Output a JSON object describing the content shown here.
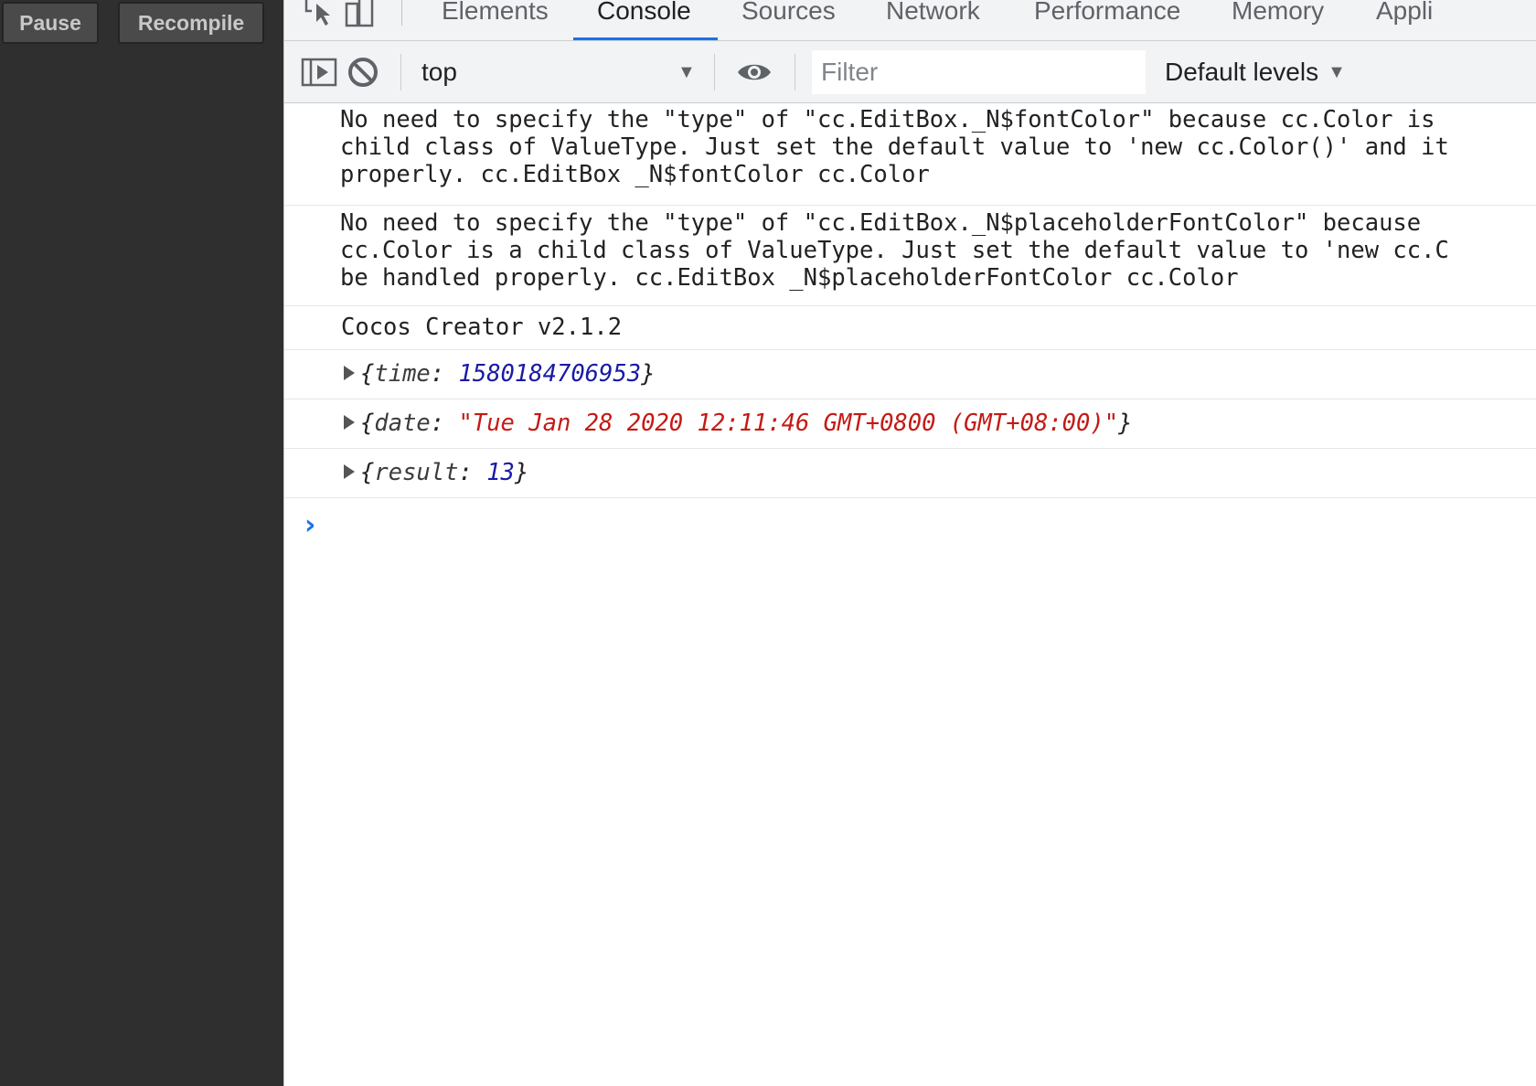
{
  "left_panel": {
    "pause_label": "Pause",
    "recompile_label": "Recompile"
  },
  "tabs": [
    {
      "label": "Elements"
    },
    {
      "label": "Console",
      "active": true
    },
    {
      "label": "Sources"
    },
    {
      "label": "Network"
    },
    {
      "label": "Performance"
    },
    {
      "label": "Memory"
    },
    {
      "label": "Appli"
    }
  ],
  "toolbar": {
    "context": "top",
    "filter_placeholder": "Filter",
    "filter_value": "",
    "levels_label": "Default levels"
  },
  "messages": [
    {
      "lines": [
        "No need to specify the \"type\" of \"cc.EditBox._N$fontColor\" because cc.Color is",
        "child class of ValueType. Just set the default value to 'new cc.Color()' and it",
        "properly. cc.EditBox _N$fontColor cc.Color"
      ]
    },
    {
      "lines": [
        "No need to specify the \"type\" of \"cc.EditBox._N$placeholderFontColor\" because",
        "cc.Color is a child class of ValueType. Just set the default value to 'new cc.C",
        "be handled properly. cc.EditBox _N$placeholderFontColor cc.Color"
      ]
    },
    {
      "lines": [
        "Cocos Creator v2.1.2"
      ]
    }
  ],
  "objects": [
    {
      "key": "time",
      "value": "1580184706953",
      "type": "number"
    },
    {
      "key": "date",
      "value": "\"Tue Jan 28 2020 12:11:46 GMT+0800 (GMT+08:00)\"",
      "type": "string"
    },
    {
      "key": "result",
      "value": "13",
      "type": "number"
    }
  ],
  "prompt_symbol": "›",
  "colors": {
    "accent": "#1a73e8",
    "number": "#1a1aa6",
    "string": "#c41a16",
    "panel_bg": "#2f2f2f"
  }
}
